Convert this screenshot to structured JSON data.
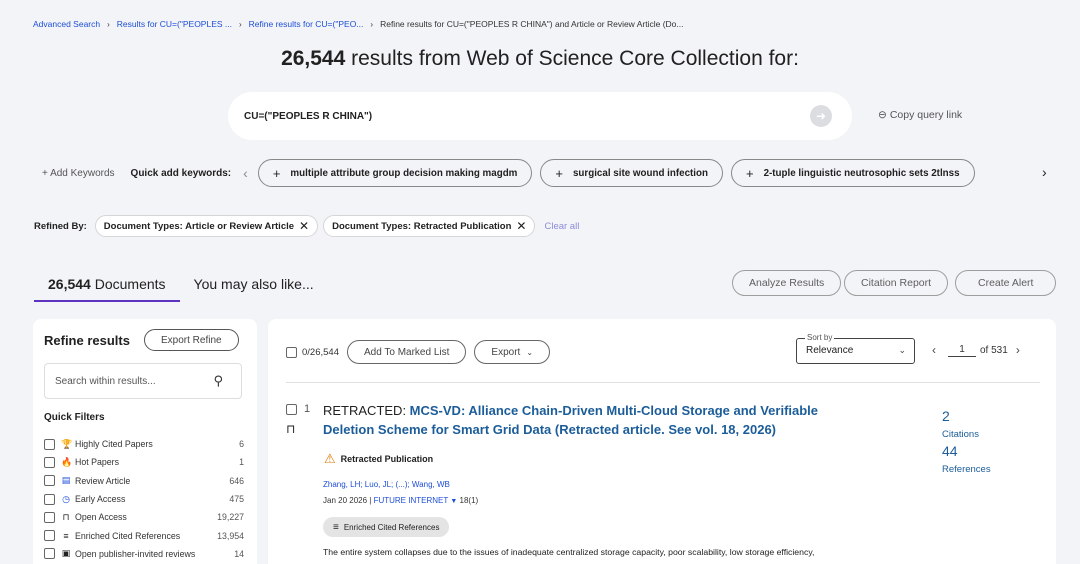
{
  "breadcrumb": {
    "items": [
      "Advanced Search",
      "Results for CU=(\"PEOPLES ...",
      "Refine results for CU=(\"PEO..."
    ],
    "current": "Refine results for CU=(\"PEOPLES R CHINA\") and Article or Review Article (Do..."
  },
  "headline": {
    "count": "26,544",
    "text": " results from Web of Science Core Collection for:"
  },
  "query": {
    "text": "CU=(\"PEOPLES R CHINA\")",
    "copy_link": "Copy query link"
  },
  "keywords": {
    "add_label": "+ Add Keywords",
    "quick_label": "Quick add keywords:",
    "chips": [
      "multiple attribute group decision making magdm",
      "surgical site wound infection",
      "2-tuple linguistic neutrosophic sets 2tlnss"
    ]
  },
  "refined": {
    "label": "Refined By:",
    "chips": [
      "Document Types: Article or Review Article",
      "Document Types: Retracted Publication"
    ],
    "clear_all": "Clear all"
  },
  "tabs": {
    "documents_count": "26,544",
    "documents_label": " Documents",
    "also_like": "You may also like..."
  },
  "actions": [
    "Analyze Results",
    "Citation Report",
    "Create Alert"
  ],
  "sidebar": {
    "title": "Refine results",
    "export_btn": "Export Refine",
    "search_placeholder": "Search within results...",
    "quick_filters_title": "Quick Filters",
    "filters": [
      {
        "label": "Highly Cited Papers",
        "count": "6",
        "icon": "trophy-icon",
        "glyph": "🏆",
        "color": "#c62828"
      },
      {
        "label": "Hot Papers",
        "count": "1",
        "icon": "flame-icon",
        "glyph": "🔥",
        "color": "#c62828"
      },
      {
        "label": "Review Article",
        "count": "646",
        "icon": "document-icon",
        "glyph": "▤",
        "color": "#1d4ed8"
      },
      {
        "label": "Early Access",
        "count": "475",
        "icon": "clock-icon",
        "glyph": "◷",
        "color": "#1d4ed8"
      },
      {
        "label": "Open Access",
        "count": "19,227",
        "icon": "lock-open-icon",
        "glyph": "⊓",
        "color": "#212121"
      },
      {
        "label": "Enriched Cited References",
        "count": "13,954",
        "icon": "enriched-icon",
        "glyph": "≡",
        "color": "#212121"
      },
      {
        "label": "Open publisher-invited reviews",
        "count": "14",
        "icon": "review-icon",
        "glyph": "▣",
        "color": "#212121"
      }
    ]
  },
  "results": {
    "selected": "0/26,544",
    "add_marked": "Add To Marked List",
    "export": "Export",
    "sort_label": "Sort by",
    "sort_value": "Relevance",
    "page": "1",
    "of_pages": "of 531",
    "record": {
      "num": "1",
      "prefix": "RETRACTED: ",
      "title": "MCS-VD: Alliance Chain-Driven Multi-Cloud Storage and Verifiable Deletion Scheme for Smart Grid Data (Retracted article. See vol. 18, 2026)",
      "retracted_label": "Retracted Publication",
      "authors": "Zhang, LH; Luo, JL; (...); Wang, WB",
      "date": "Jan 20 2026",
      "journal": "FUTURE INTERNET",
      "volume": "18(1)",
      "enriched": "Enriched Cited References",
      "abstract": "The entire system collapses due to the issues of inadequate centralized storage capacity, poor scalability, low storage efficiency,",
      "citations_count": "2",
      "citations_label": "Citations",
      "references_count": "44",
      "references_label": "References"
    }
  },
  "colors": {
    "accent": "#5e33bf",
    "link": "#1c5d99",
    "background": "#f3f4f7"
  }
}
